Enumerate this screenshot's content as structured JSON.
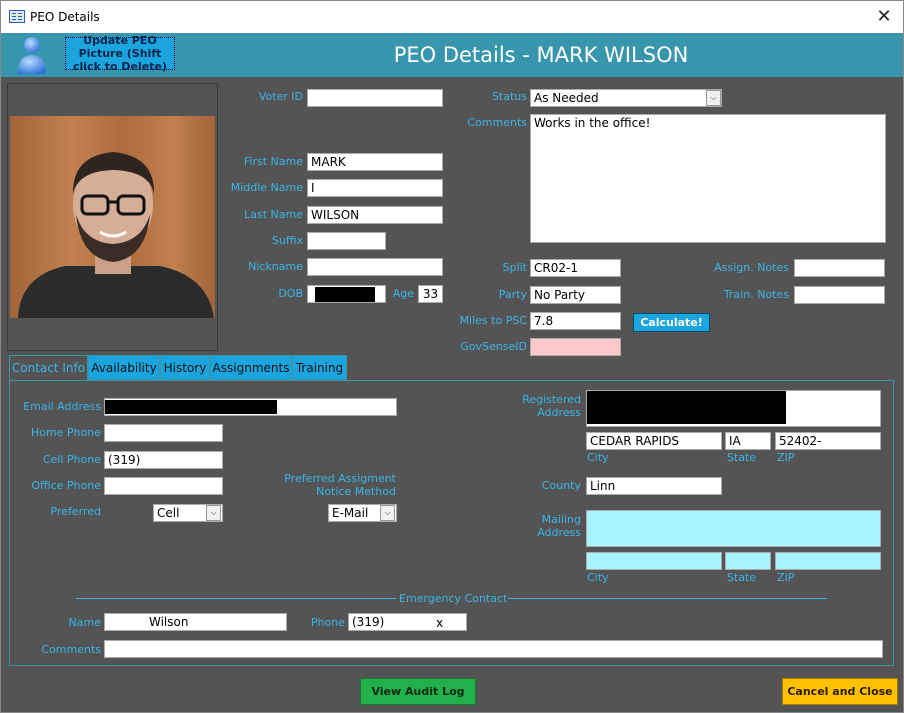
{
  "window": {
    "title": "PEO Details",
    "close_glyph": "✕"
  },
  "header": {
    "update_picture_button": "Update PEO Picture (Shift click to Delete)",
    "title": "PEO Details - MARK WILSON",
    "accent_color": "#3796ad"
  },
  "fields": {
    "voter_id": {
      "label": "Voter ID",
      "value": ""
    },
    "first_name": {
      "label": "First Name",
      "value": "MARK"
    },
    "middle_name": {
      "label": "Middle Name",
      "value": "I"
    },
    "last_name": {
      "label": "Last Name",
      "value": "WILSON"
    },
    "suffix": {
      "label": "Suffix",
      "value": ""
    },
    "nickname": {
      "label": "Nickname",
      "value": ""
    },
    "dob": {
      "label": "DOB",
      "value": ""
    },
    "age": {
      "label": "Age",
      "value": "33"
    },
    "status": {
      "label": "Status",
      "value": "As Needed"
    },
    "comments": {
      "label": "Comments",
      "value": "Works in the office!"
    },
    "split": {
      "label": "Split",
      "value": "CR02-1"
    },
    "party": {
      "label": "Party",
      "value": "No Party"
    },
    "miles_to_psc": {
      "label": "Miles to PSC",
      "value": "7.8"
    },
    "govsense_id": {
      "label": "GovSenseID",
      "value": ""
    },
    "assign_notes": {
      "label": "Assign. Notes",
      "value": ""
    },
    "train_notes": {
      "label": "Train. Notes",
      "value": ""
    },
    "calculate_button": "Calculate!"
  },
  "tabs": [
    {
      "label": "Contact Info",
      "active": true
    },
    {
      "label": "Availability",
      "active": false
    },
    {
      "label": "History",
      "active": false
    },
    {
      "label": "Assignments",
      "active": false
    },
    {
      "label": "Training",
      "active": false
    }
  ],
  "contact": {
    "email": {
      "label": "Email Address",
      "value": ""
    },
    "home_phone": {
      "label": "Home Phone",
      "value": ""
    },
    "cell_phone": {
      "label": "Cell Phone",
      "value": "(319)"
    },
    "office_phone": {
      "label": "Office Phone",
      "value": ""
    },
    "preferred": {
      "label": "Preferred",
      "value": "Cell"
    },
    "notice_method": {
      "label": "Preferred Assigment Notice Method",
      "value": "E-Mail"
    },
    "registered_address": {
      "label": "Registered Address",
      "city": "CEDAR RAPIDS",
      "state": "IA",
      "zip": "52402-"
    },
    "sub_labels": {
      "city": "City",
      "state": "State",
      "zip": "ZIP"
    },
    "county": {
      "label": "County",
      "value": "Linn"
    },
    "mailing_address": {
      "label": "Mailing Address",
      "city": "",
      "state": "",
      "zip": ""
    },
    "emergency": {
      "section_label": "Emergency Contact",
      "name_label": "Name",
      "name_value": "Wilson",
      "phone_label": "Phone",
      "phone_value": "(319)",
      "phone_ext": "x",
      "comments_label": "Comments",
      "comments_value": ""
    }
  },
  "footer": {
    "view_audit_log": "View Audit Log",
    "cancel_and_close": "Cancel and Close",
    "audit_color": "#22b04b",
    "cancel_color": "#ffc000"
  },
  "icons": {
    "window_icon": "form-icon",
    "header_icon": "person-icon",
    "combo": "dropdown-arrow-icon"
  }
}
